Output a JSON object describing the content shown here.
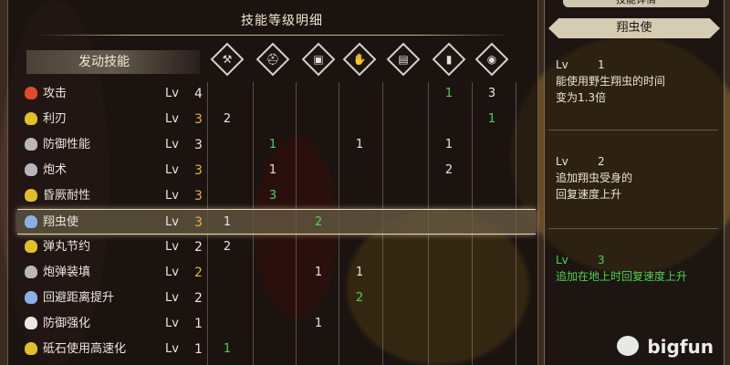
{
  "left_panel": {
    "title": "技能等级明细",
    "header_label": "发动技能",
    "columns": [
      {
        "icon": "weapon-icon",
        "glyph": "⚒"
      },
      {
        "icon": "helmet-icon",
        "glyph": "⛑"
      },
      {
        "icon": "chest-armor-icon",
        "glyph": "▣"
      },
      {
        "icon": "arm-armor-icon",
        "glyph": "✋"
      },
      {
        "icon": "waist-armor-icon",
        "glyph": "▤"
      },
      {
        "icon": "leg-armor-icon",
        "glyph": "▮"
      },
      {
        "icon": "talisman-icon",
        "glyph": "◉"
      }
    ],
    "lv_label": "Lv",
    "skills": [
      {
        "name": "攻击",
        "icon_color": "#e04a2a",
        "level": "4",
        "level_color": "white",
        "cells": [
          "",
          "",
          "",
          "",
          "",
          "1",
          "3"
        ],
        "cell_colors": [
          "",
          "",
          "",
          "",
          "",
          "green",
          "white"
        ]
      },
      {
        "name": "利刃",
        "icon_color": "#e0c02a",
        "level": "3",
        "level_color": "gold",
        "cells": [
          "2",
          "",
          "",
          "",
          "",
          "",
          "1"
        ],
        "cell_colors": [
          "white",
          "",
          "",
          "",
          "",
          "",
          "green"
        ]
      },
      {
        "name": "防御性能",
        "icon_color": "#b8b8b8",
        "level": "3",
        "level_color": "white",
        "cells": [
          "",
          "1",
          "",
          "1",
          "",
          "1",
          ""
        ],
        "cell_colors": [
          "",
          "green",
          "",
          "white",
          "",
          "white",
          ""
        ]
      },
      {
        "name": "炮术",
        "icon_color": "#b8b8b8",
        "level": "3",
        "level_color": "gold",
        "cells": [
          "",
          "1",
          "",
          "",
          "",
          "2",
          ""
        ],
        "cell_colors": [
          "",
          "white",
          "",
          "",
          "",
          "white",
          ""
        ]
      },
      {
        "name": "昏厥耐性",
        "icon_color": "#e0c02a",
        "level": "3",
        "level_color": "gold",
        "cells": [
          "",
          "3",
          "",
          "",
          "",
          "",
          ""
        ],
        "cell_colors": [
          "",
          "green",
          "",
          "",
          "",
          "",
          ""
        ]
      },
      {
        "name": "翔虫使",
        "icon_color": "#8ab0e8",
        "level": "3",
        "level_color": "gold",
        "cells": [
          "1",
          "",
          "2",
          "",
          "",
          "",
          ""
        ],
        "cell_colors": [
          "white",
          "",
          "green",
          "",
          "",
          "",
          ""
        ]
      },
      {
        "name": "弹丸节约",
        "icon_color": "#e0c02a",
        "level": "2",
        "level_color": "white",
        "cells": [
          "2",
          "",
          "",
          "",
          "",
          "",
          ""
        ],
        "cell_colors": [
          "white",
          "",
          "",
          "",
          "",
          "",
          ""
        ]
      },
      {
        "name": "炮弹装填",
        "icon_color": "#b8b8b8",
        "level": "2",
        "level_color": "gold",
        "cells": [
          "",
          "",
          "1",
          "1",
          "",
          "",
          ""
        ],
        "cell_colors": [
          "",
          "",
          "white",
          "white",
          "",
          "",
          ""
        ]
      },
      {
        "name": "回避距离提升",
        "icon_color": "#8ab0e8",
        "level": "2",
        "level_color": "white",
        "cells": [
          "",
          "",
          "",
          "2",
          "",
          "",
          ""
        ],
        "cell_colors": [
          "",
          "",
          "",
          "green",
          "",
          "",
          ""
        ]
      },
      {
        "name": "防御强化",
        "icon_color": "#e8e8e8",
        "level": "1",
        "level_color": "white",
        "cells": [
          "",
          "",
          "1",
          "",
          "",
          "",
          ""
        ],
        "cell_colors": [
          "",
          "",
          "white",
          "",
          "",
          "",
          ""
        ]
      },
      {
        "name": "砥石使用高速化",
        "icon_color": "#e0c02a",
        "level": "1",
        "level_color": "white",
        "cells": [
          "1",
          "",
          "",
          "",
          "",
          "",
          ""
        ],
        "cell_colors": [
          "green",
          "",
          "",
          "",
          "",
          "",
          ""
        ]
      }
    ],
    "selected_index": 5
  },
  "right_panel": {
    "tab_label": "技能详情",
    "skill_name": "翔虫使",
    "levels": [
      {
        "lv_label": "Lv",
        "lv": "1",
        "desc_line1": "能使用野生翔虫的时间",
        "desc_line2": "变为1.3倍",
        "color": "white"
      },
      {
        "lv_label": "Lv",
        "lv": "2",
        "desc_line1": "追加翔虫受身的",
        "desc_line2": "回复速度上升",
        "color": "white"
      },
      {
        "lv_label": "Lv",
        "lv": "3",
        "desc_line1": "追加在地上时回复速度上升",
        "desc_line2": "",
        "color": "green"
      }
    ]
  },
  "watermark": "bigfun",
  "colors": {
    "white": "#ece6d8",
    "gold": "#e7b43a",
    "green": "#4fd24f"
  }
}
